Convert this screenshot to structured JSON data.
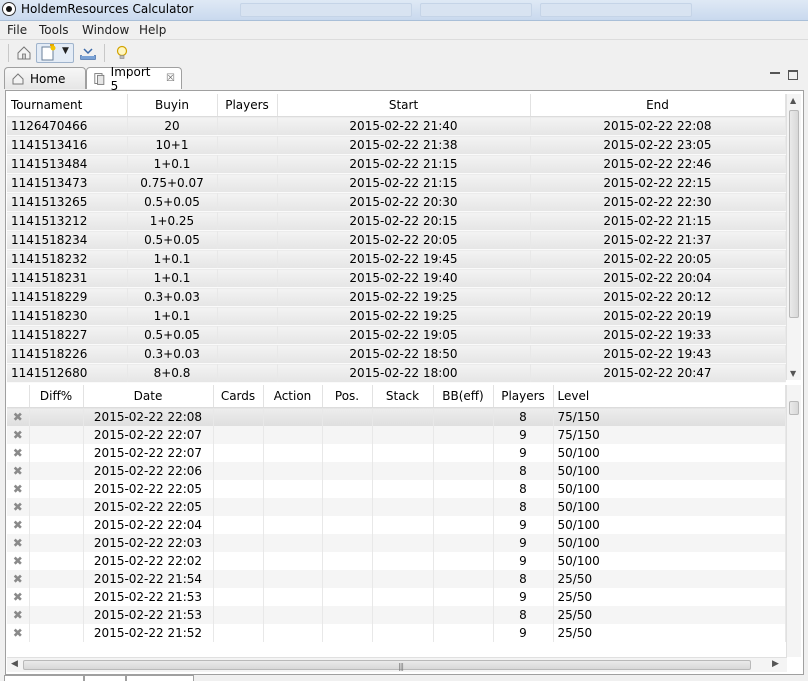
{
  "window": {
    "title": "HoldemResources Calculator"
  },
  "menu": [
    "File",
    "Tools",
    "Window",
    "Help"
  ],
  "tabs": [
    {
      "label": "Home",
      "icon": "home-icon"
    },
    {
      "label": "Import 5",
      "icon": "import-icon"
    }
  ],
  "top_table": {
    "columns": [
      "Tournament",
      "Buyin",
      "Players",
      "Start",
      "End"
    ],
    "rows": [
      [
        "1126470466",
        "20",
        "",
        "2015-02-22 21:40",
        "2015-02-22 22:08"
      ],
      [
        "1141513416",
        "10+1",
        "",
        "2015-02-22 21:38",
        "2015-02-22 23:05"
      ],
      [
        "1141513484",
        "1+0.1",
        "",
        "2015-02-22 21:15",
        "2015-02-22 22:46"
      ],
      [
        "1141513473",
        "0.75+0.07",
        "",
        "2015-02-22 21:15",
        "2015-02-22 22:15"
      ],
      [
        "1141513265",
        "0.5+0.05",
        "",
        "2015-02-22 20:30",
        "2015-02-22 22:30"
      ],
      [
        "1141513212",
        "1+0.25",
        "",
        "2015-02-22 20:15",
        "2015-02-22 21:15"
      ],
      [
        "1141518234",
        "0.5+0.05",
        "",
        "2015-02-22 20:05",
        "2015-02-22 21:37"
      ],
      [
        "1141518232",
        "1+0.1",
        "",
        "2015-02-22 19:45",
        "2015-02-22 20:05"
      ],
      [
        "1141518231",
        "1+0.1",
        "",
        "2015-02-22 19:40",
        "2015-02-22 20:04"
      ],
      [
        "1141518229",
        "0.3+0.03",
        "",
        "2015-02-22 19:25",
        "2015-02-22 20:12"
      ],
      [
        "1141518230",
        "1+0.1",
        "",
        "2015-02-22 19:25",
        "2015-02-22 20:19"
      ],
      [
        "1141518227",
        "0.5+0.05",
        "",
        "2015-02-22 19:05",
        "2015-02-22 19:33"
      ],
      [
        "1141518226",
        "0.3+0.03",
        "",
        "2015-02-22 18:50",
        "2015-02-22 19:43"
      ],
      [
        "1141512680",
        "8+0.8",
        "",
        "2015-02-22 18:00",
        "2015-02-22 20:47"
      ]
    ]
  },
  "bottom_table": {
    "columns": [
      "",
      "Diff%",
      "Date",
      "Cards",
      "Action",
      "Pos.",
      "Stack",
      "BB(eff)",
      "Players",
      "Level"
    ],
    "rows": [
      [
        "2015-02-22 22:08",
        "8",
        "75/150"
      ],
      [
        "2015-02-22 22:07",
        "9",
        "75/150"
      ],
      [
        "2015-02-22 22:07",
        "9",
        "50/100"
      ],
      [
        "2015-02-22 22:06",
        "8",
        "50/100"
      ],
      [
        "2015-02-22 22:05",
        "8",
        "50/100"
      ],
      [
        "2015-02-22 22:05",
        "8",
        "50/100"
      ],
      [
        "2015-02-22 22:04",
        "9",
        "50/100"
      ],
      [
        "2015-02-22 22:03",
        "9",
        "50/100"
      ],
      [
        "2015-02-22 22:02",
        "9",
        "50/100"
      ],
      [
        "2015-02-22 21:54",
        "8",
        "25/50"
      ],
      [
        "2015-02-22 21:53",
        "9",
        "25/50"
      ],
      [
        "2015-02-22 21:53",
        "8",
        "25/50"
      ],
      [
        "2015-02-22 21:52",
        "9",
        "25/50"
      ]
    ]
  }
}
